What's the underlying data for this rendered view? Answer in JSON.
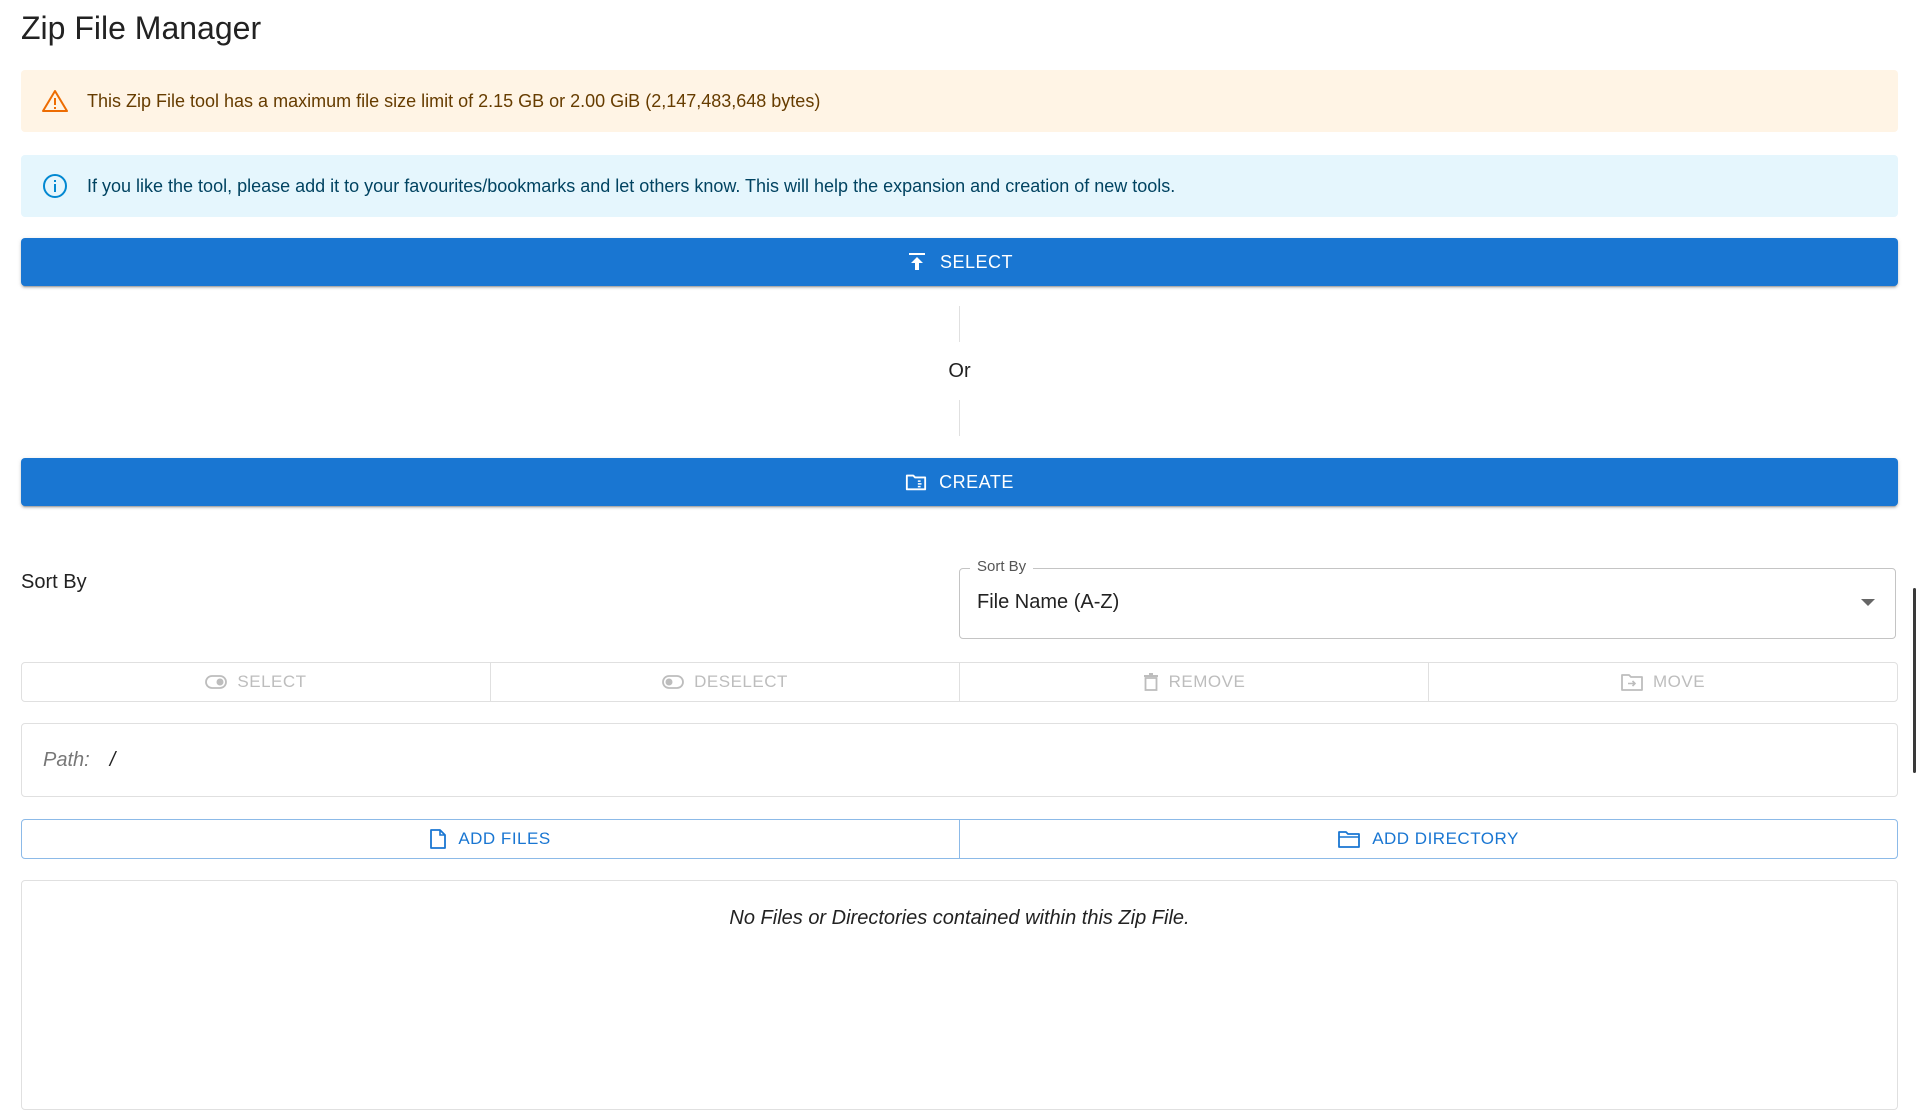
{
  "page": {
    "title": "Zip File Manager"
  },
  "alerts": {
    "warning": {
      "text": "This Zip File tool has a maximum file size limit of 2.15 GB or 2.00 GiB (2,147,483,648 bytes)",
      "icon": "warning-triangle-icon",
      "color": "#ed6c02"
    },
    "info": {
      "text": "If you like the tool, please add it to your favourites/bookmarks and let others know. This will help the expansion and creation of new tools.",
      "icon": "info-circle-icon",
      "color": "#0288d1"
    }
  },
  "actions": {
    "select_label": "SELECT",
    "or_label": "Or",
    "create_label": "CREATE",
    "primary_color": "#1976d2"
  },
  "sort": {
    "label": "Sort By",
    "field_label": "Sort By",
    "value": "File Name (A-Z)"
  },
  "toolbar": {
    "select_label": "SELECT",
    "deselect_label": "DESELECT",
    "remove_label": "REMOVE",
    "move_label": "MOVE"
  },
  "path": {
    "label": "Path:",
    "value": "/"
  },
  "add": {
    "files_label": "ADD FILES",
    "directory_label": "ADD DIRECTORY"
  },
  "files": {
    "empty_message": "No Files or Directories contained within this Zip File."
  }
}
